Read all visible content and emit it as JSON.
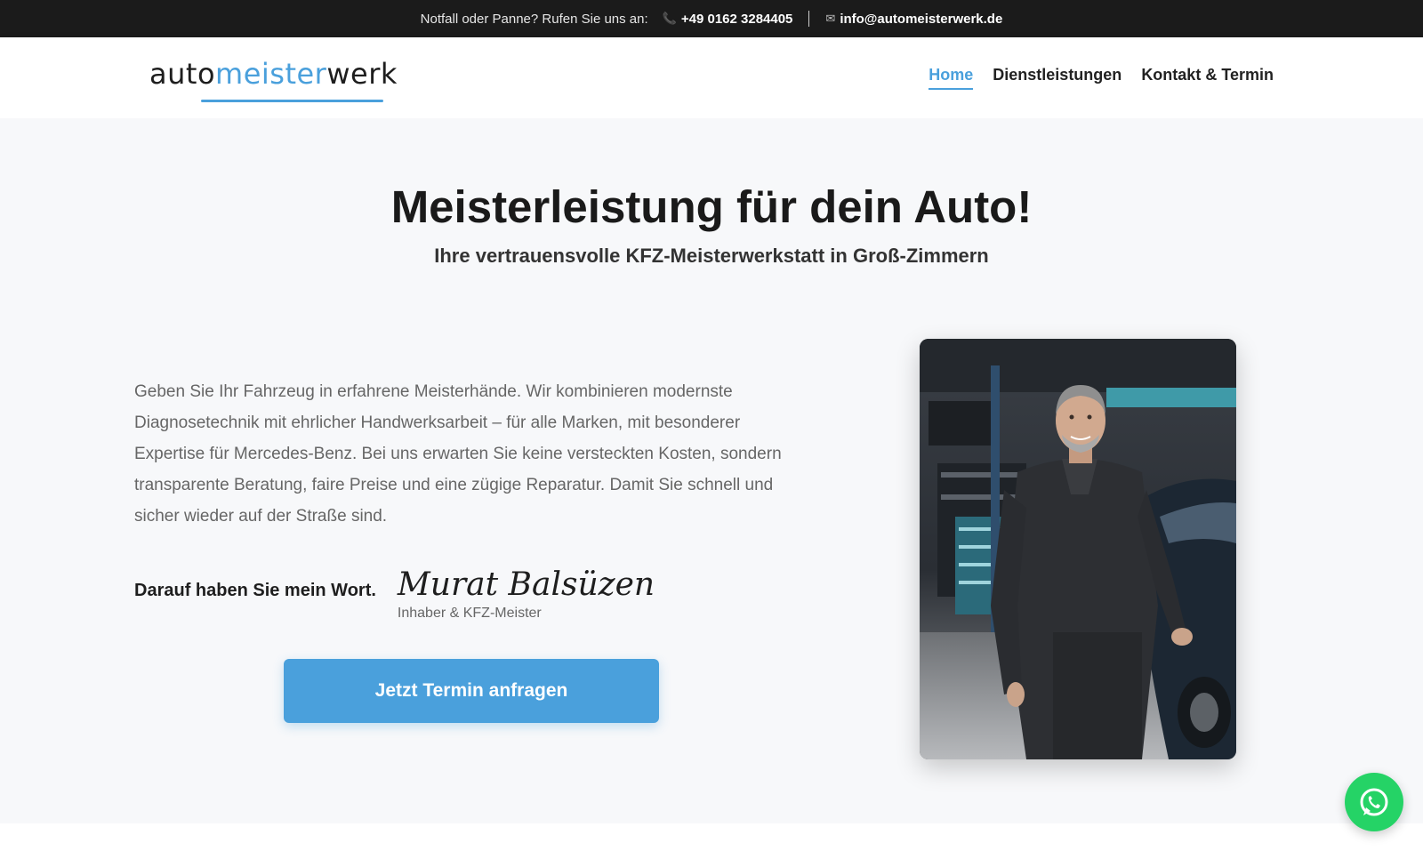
{
  "topbar": {
    "emergency_label": "Notfall oder Panne? Rufen Sie uns an:",
    "phone": "+49 0162 3284405",
    "phone_icon": "phone-icon",
    "email": "info@automeisterwerk.de",
    "email_icon": "mail-icon"
  },
  "logo": {
    "part1": "auto",
    "part2": "meister",
    "part3": "werk",
    "accent_color": "#4aa0dc"
  },
  "nav": {
    "items": [
      {
        "label": "Home",
        "active": true
      },
      {
        "label": "Dienstleistungen",
        "active": false
      },
      {
        "label": "Kontakt & Termin",
        "active": false
      }
    ]
  },
  "hero": {
    "title": "Meisterleistung für dein Auto!",
    "subtitle": "Ihre vertrauensvolle KFZ-Meisterwerkstatt in Groß-Zimmern",
    "body": "Geben Sie Ihr Fahrzeug in erfahrene Meisterhände. Wir kombinieren modernste Diagnosetechnik mit ehrlicher Handwerksarbeit – für alle Marken, mit besonderer Expertise für Mercedes-Benz. Bei uns erwarten Sie keine versteckten Kosten, sondern transparente Beratung, faire Preise und eine zügige Reparatur. Damit Sie schnell und sicher wieder auf der Straße sind.",
    "promise": "Darauf haben Sie mein Wort.",
    "signature": "Murat Balsüzen",
    "role": "Inhaber & KFZ-Meister",
    "cta_label": "Jetzt Termin anfragen"
  },
  "colors": {
    "accent": "#4aa0dc",
    "topbar_bg": "#1b1b1b",
    "whatsapp": "#25d366"
  },
  "floating": {
    "whatsapp_icon": "whatsapp-icon"
  }
}
